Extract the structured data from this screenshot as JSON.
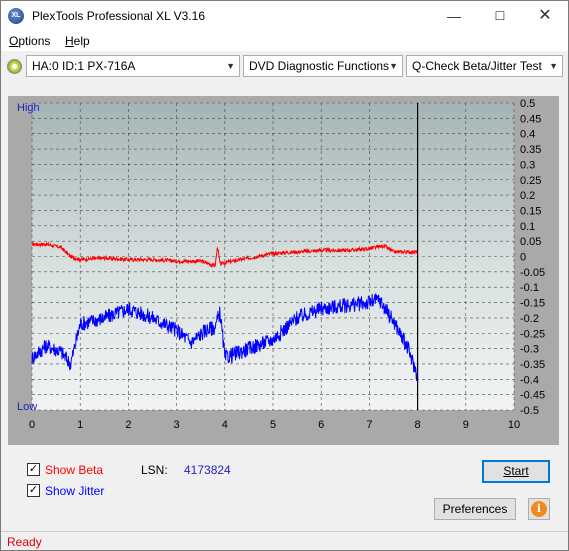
{
  "window": {
    "title": "PlexTools Professional XL V3.16",
    "icon_text": "XL",
    "controls": [
      "minimize",
      "maximize",
      "close"
    ]
  },
  "menu": {
    "items": [
      {
        "label": "Options",
        "accel": "O",
        "rest": "ptions"
      },
      {
        "label": "Help",
        "accel": "H",
        "rest": "elp"
      }
    ]
  },
  "toolbar": {
    "drive": "HA:0 ID:1  PX-716A",
    "function": "DVD Diagnostic Functions",
    "test": "Q-Check Beta/Jitter Test"
  },
  "chart_labels": {
    "high": "High",
    "low": "Low"
  },
  "chart_data": {
    "type": "line",
    "x_ticks": [
      "0",
      "1",
      "2",
      "3",
      "4",
      "5",
      "6",
      "7",
      "8",
      "9",
      "10"
    ],
    "xlim": [
      0,
      10
    ],
    "y_right_ticks": [
      "0.5",
      "0.45",
      "0.4",
      "0.35",
      "0.3",
      "0.25",
      "0.2",
      "0.15",
      "0.1",
      "0.05",
      "0",
      "-0.05",
      "-0.1",
      "-0.15",
      "-0.2",
      "-0.25",
      "-0.3",
      "-0.35",
      "-0.4",
      "-0.45",
      "-0.5"
    ],
    "ylim": [
      -0.5,
      0.5
    ],
    "grid": true,
    "end_marker_x": 8,
    "series": [
      {
        "name": "Beta",
        "color": "#ff0000",
        "x": [
          0,
          0.3,
          0.6,
          0.8,
          1.0,
          1.5,
          2.0,
          2.5,
          3.0,
          3.5,
          3.8,
          3.85,
          3.9,
          4.0,
          4.5,
          5.0,
          5.5,
          6.0,
          6.5,
          7.0,
          7.3,
          7.5,
          8.0
        ],
        "values": [
          0.04,
          0.04,
          0.03,
          0.0,
          -0.01,
          -0.005,
          -0.01,
          -0.01,
          -0.015,
          -0.015,
          -0.03,
          0.035,
          -0.025,
          -0.02,
          -0.005,
          0.01,
          0.015,
          0.02,
          0.02,
          0.025,
          0.035,
          0.015,
          0.015
        ]
      },
      {
        "name": "Jitter",
        "color": "#0000ff",
        "x": [
          0,
          0.3,
          0.6,
          0.8,
          1.0,
          1.5,
          2.0,
          2.5,
          3.0,
          3.3,
          3.6,
          3.8,
          3.9,
          4.0,
          4.5,
          5.0,
          5.5,
          6.0,
          6.5,
          7.0,
          7.2,
          7.5,
          7.8,
          8.0
        ],
        "values": [
          -0.33,
          -0.29,
          -0.31,
          -0.35,
          -0.22,
          -0.2,
          -0.17,
          -0.2,
          -0.24,
          -0.28,
          -0.24,
          -0.23,
          -0.18,
          -0.33,
          -0.3,
          -0.27,
          -0.2,
          -0.17,
          -0.16,
          -0.15,
          -0.14,
          -0.21,
          -0.3,
          -0.39
        ]
      }
    ]
  },
  "options": {
    "show_beta": {
      "label": "Show Beta",
      "checked": true,
      "color": "#ff0000"
    },
    "show_jitter": {
      "label": "Show Jitter",
      "checked": true,
      "color": "#0000ff"
    },
    "lsn_label": "LSN:",
    "lsn_value": "4173824"
  },
  "buttons": {
    "start": "Start",
    "preferences": "Preferences",
    "info_icon": "info-icon"
  },
  "status": {
    "text": "Ready",
    "color": "#e00000"
  }
}
